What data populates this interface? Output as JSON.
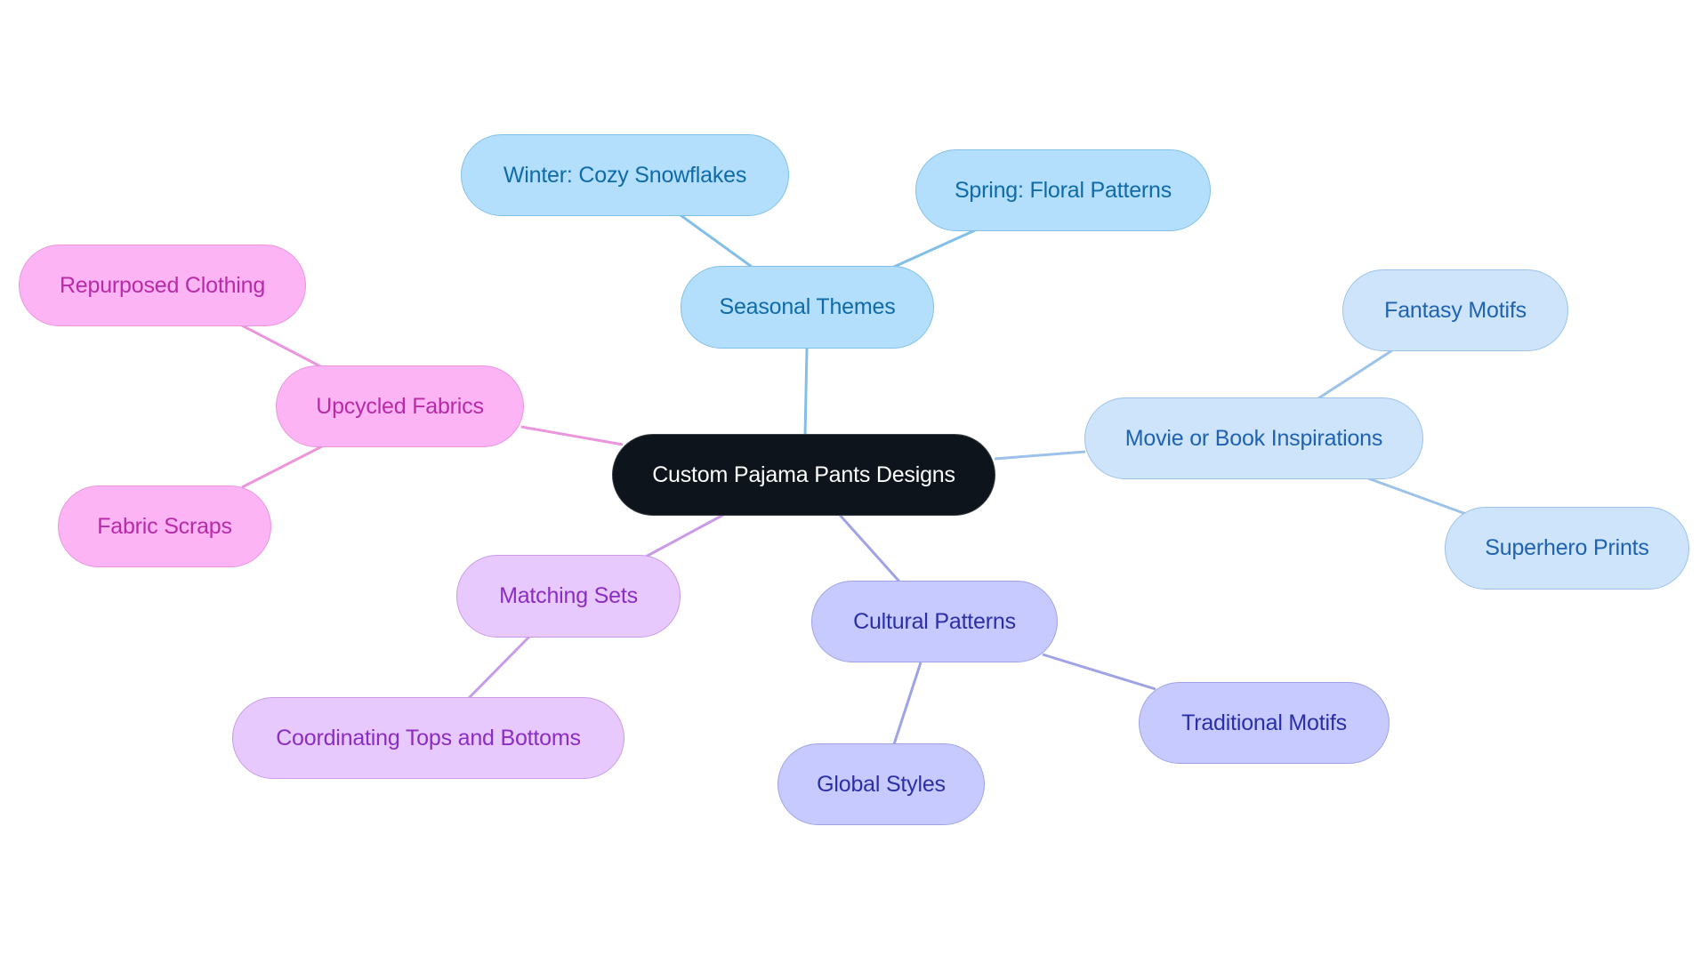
{
  "diagram": {
    "type": "mind-map",
    "root": {
      "id": "root",
      "label": "Custom Pajama Pants Designs"
    },
    "branches": [
      {
        "id": "seasonal",
        "label": "Seasonal Themes",
        "color": "#82bfe8",
        "children": [
          {
            "id": "winter",
            "label": "Winter: Cozy Snowflakes"
          },
          {
            "id": "spring",
            "label": "Spring: Floral Patterns"
          }
        ]
      },
      {
        "id": "movie",
        "label": "Movie or Book Inspirations",
        "color": "#9cc2ea",
        "children": [
          {
            "id": "fantasy",
            "label": "Fantasy Motifs"
          },
          {
            "id": "superhero",
            "label": "Superhero Prints"
          }
        ]
      },
      {
        "id": "cultural",
        "label": "Cultural Patterns",
        "color": "#9fa3e6",
        "children": [
          {
            "id": "traditional",
            "label": "Traditional Motifs"
          },
          {
            "id": "global",
            "label": "Global Styles"
          }
        ]
      },
      {
        "id": "matching",
        "label": "Matching Sets",
        "color": "#c89ae8",
        "children": [
          {
            "id": "coordinating",
            "label": "Coordinating Tops and Bottoms"
          }
        ]
      },
      {
        "id": "upcycled",
        "label": "Upcycled Fabrics",
        "color": "#ea95de",
        "children": [
          {
            "id": "repurposed",
            "label": "Repurposed Clothing"
          },
          {
            "id": "scraps",
            "label": "Fabric Scraps"
          }
        ]
      }
    ]
  }
}
